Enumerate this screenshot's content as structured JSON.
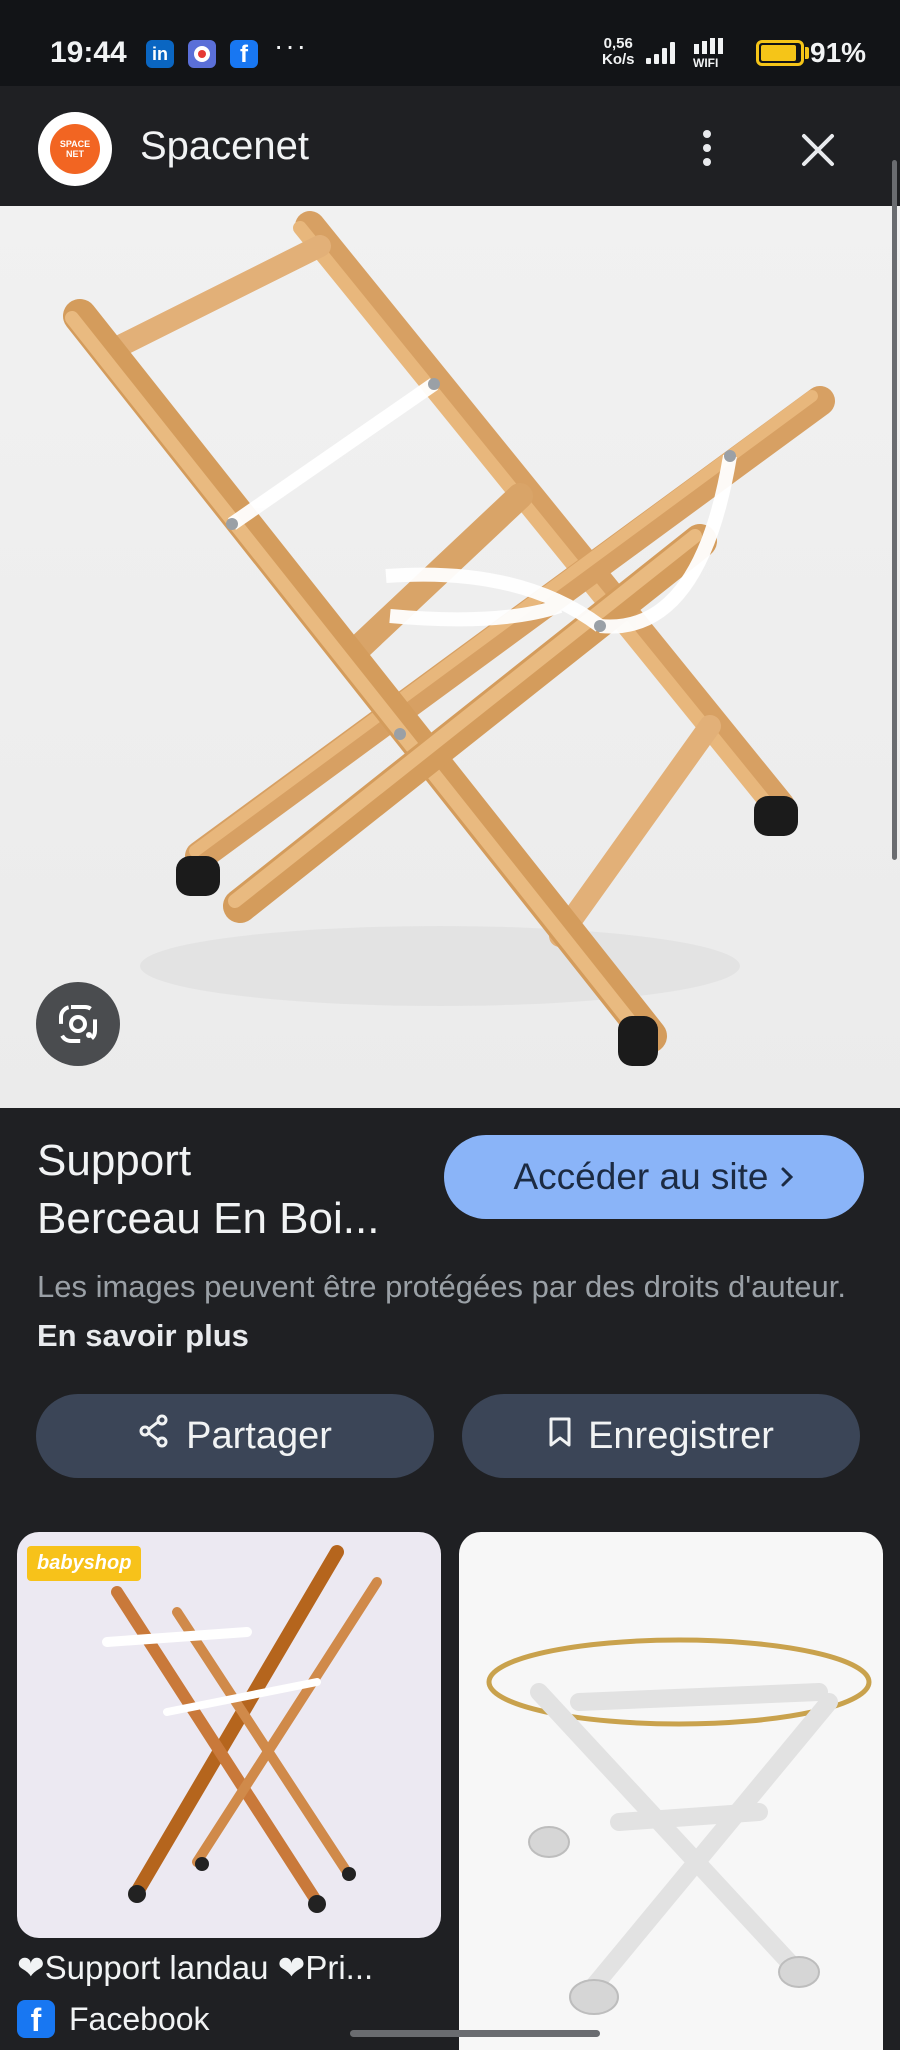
{
  "status_bar": {
    "time": "19:44",
    "more": "···",
    "speed_value": "0,56",
    "speed_unit": "Ko/s",
    "wifi_label": "WIFI",
    "battery": "91%",
    "battery_level": 0.91,
    "app_icons": [
      "linkedin-icon",
      "game-app-icon",
      "facebook-icon"
    ]
  },
  "header": {
    "site_name": "Spacenet",
    "logo_text": "SPACE NET",
    "menu_icon": "more-vert-icon",
    "close_icon": "close-icon"
  },
  "main_image": {
    "subject": "wooden-cradle-stand",
    "lens_icon": "google-lens-icon"
  },
  "result": {
    "title": "Support\nBerceau En Boi...",
    "visit_label": "Accéder au site",
    "visit_icon": "chevron-right-icon",
    "copyright_text": "Les images peuvent être protégées par des droits d'auteur.",
    "learn_more": "En savoir plus"
  },
  "actions": {
    "share_label": "Partager",
    "share_icon": "share-icon",
    "save_label": "Enregistrer",
    "save_icon": "bookmark-icon"
  },
  "related": [
    {
      "badge": "babyshop",
      "caption": "❤Support landau ❤Pri...",
      "source": "Facebook",
      "source_icon": "facebook-icon"
    },
    {
      "subject": "white-cradle-stand"
    }
  ],
  "colors": {
    "background": "#1f2023",
    "accent": "#8ab4f8",
    "action_button": "#3b4557",
    "battery": "#f5c518"
  }
}
